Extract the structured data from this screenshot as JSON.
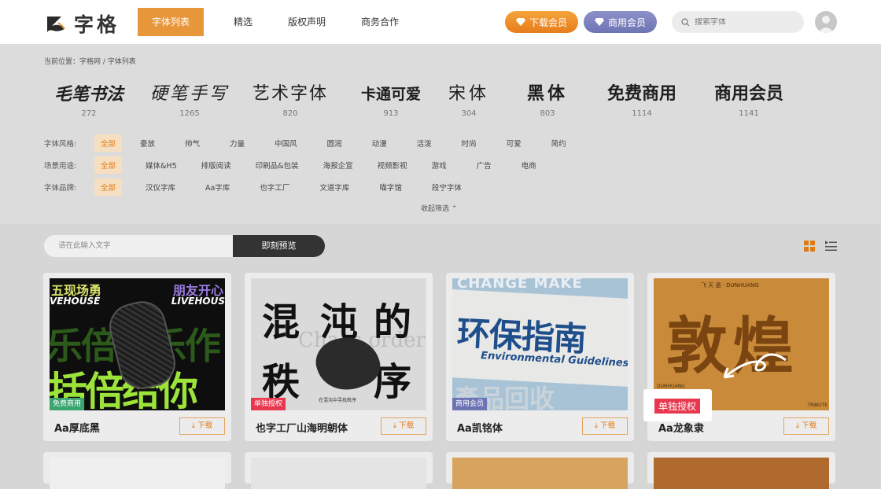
{
  "header": {
    "logo_text": "字格",
    "nav": [
      "字体列表",
      "精选",
      "版权声明",
      "商务合作"
    ],
    "vip_download": "下载会员",
    "vip_commercial": "商用会员",
    "search_placeholder": "搜索字体"
  },
  "breadcrumb": "当前位置：字格网 / 字体列表",
  "categories": [
    {
      "name": "毛笔书法",
      "count": "272"
    },
    {
      "name": "硬笔手写",
      "count": "1265"
    },
    {
      "name": "艺术字体",
      "count": "820"
    },
    {
      "name": "卡通可爱",
      "count": "913"
    },
    {
      "name": "宋体",
      "count": "304"
    },
    {
      "name": "黑体",
      "count": "803"
    },
    {
      "name": "免费商用",
      "count": "1114"
    },
    {
      "name": "商用会员",
      "count": "1141"
    }
  ],
  "filters": {
    "style": {
      "label": "字体风格:",
      "options": [
        "全部",
        "豪放",
        "帅气",
        "力量",
        "中国风",
        "圆润",
        "动漫",
        "活泼",
        "时尚",
        "可爱",
        "简约"
      ]
    },
    "scene": {
      "label": "场景用途:",
      "options": [
        "全部",
        "媒体&H5",
        "排版阅读",
        "印刷品&包装",
        "海报企宣",
        "视频影视",
        "游戏",
        "广告",
        "电商"
      ]
    },
    "brand": {
      "label": "字体品牌:",
      "options": [
        "全部",
        "汉仪字库",
        "Aa字库",
        "也字工厂",
        "文道字库",
        "喵字馆",
        "段宁字体"
      ]
    },
    "collapse": "收起筛选 ⌃"
  },
  "preview": {
    "placeholder": "请在此输入文字",
    "button": "即刻预览"
  },
  "cards": [
    {
      "name": "Aa厚底黑",
      "badge": "免费商用",
      "badge_color": "#3aa56f",
      "download": "⤓ 下载",
      "thumb_text": {
        "top_left": "五现场勇",
        "top_right": "朋友开心",
        "row1": "VEHOUSE",
        "row1b": "LIVEHOUS",
        "big1": "乐倍心乐作",
        "big2": "括倍给你"
      }
    },
    {
      "name": "也字工厂山海明朝体",
      "badge": "单独授权",
      "badge_color": "#e8384f",
      "download": "⤓ 下载",
      "thumb_text": {
        "chars": [
          "混",
          "沌",
          "的",
          "秩",
          "序"
        ],
        "small": "在混沌中寻找秩序",
        "ghost": "Chaos order"
      }
    },
    {
      "name": "Aa凯铭体",
      "badge": "商用会员",
      "badge_color": "#6e73b3",
      "download": "⤓ 下载",
      "thumb_text": {
        "top": "CHANGE MAKE",
        "main": "环保指南",
        "en": "Environmental Guidelines",
        "bottom": "產品回收"
      }
    },
    {
      "name": "Aa龙象隶",
      "badge": "单独授权",
      "badge_color": "#e8384f",
      "download": "⤓ 下载",
      "thumb_text": {
        "top": "飞 天 遗 · DUNHUANG",
        "main": "敦煌",
        "corner_left": "DUNHUANG",
        "corner_right": "TRIBUTE"
      }
    }
  ]
}
